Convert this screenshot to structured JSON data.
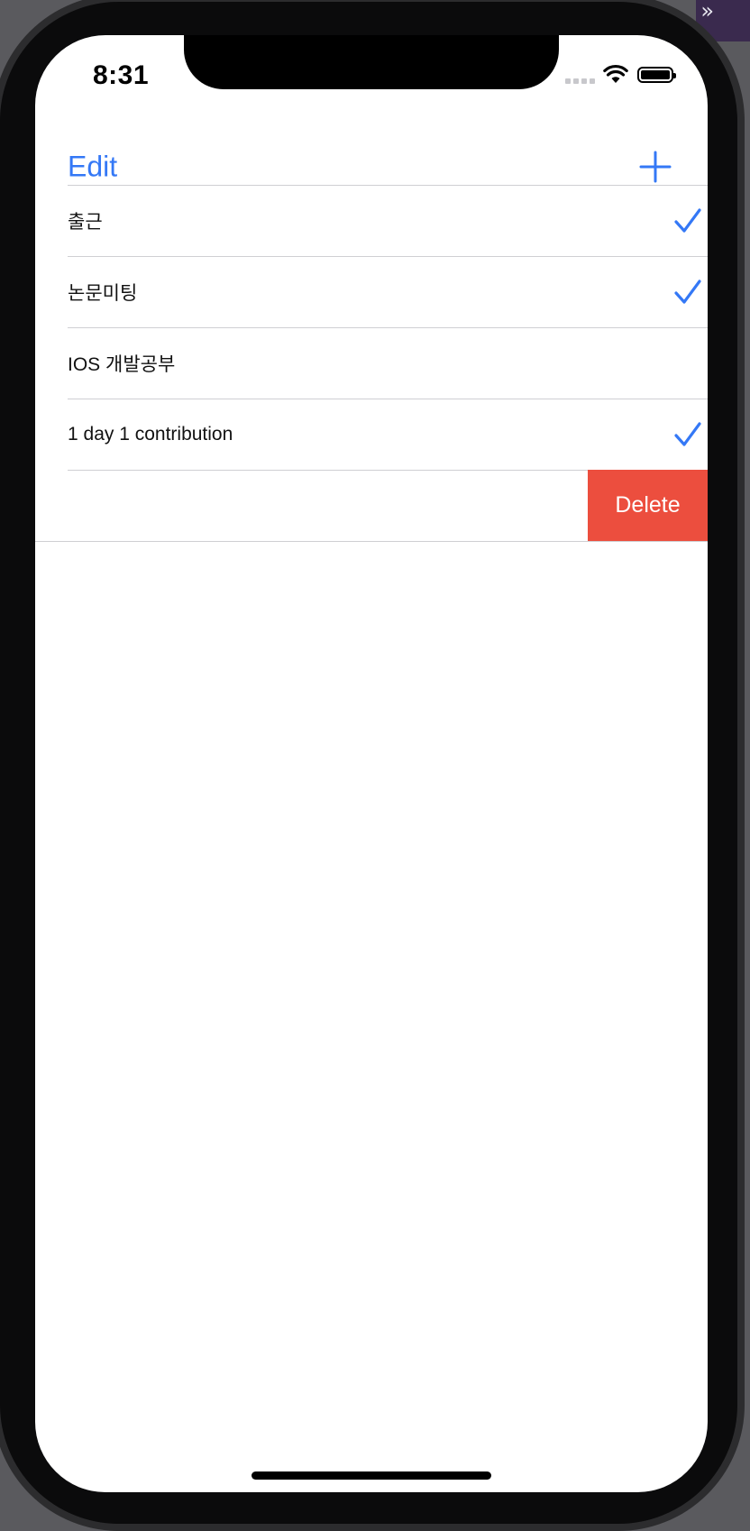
{
  "status_bar": {
    "time": "8:31"
  },
  "nav": {
    "edit_label": "Edit",
    "add_icon": "plus-icon"
  },
  "todos": [
    {
      "label": "출근",
      "done": true
    },
    {
      "label": "논문미팅",
      "done": true
    },
    {
      "label": "IOS 개발공부",
      "done": false
    },
    {
      "label": "1 day 1 contribution",
      "done": true
    }
  ],
  "swipe_action": {
    "delete_label": "Delete"
  },
  "colors": {
    "accent": "#3478f6",
    "destructive": "#ec4e3e",
    "separator": "#cfcfd3"
  }
}
